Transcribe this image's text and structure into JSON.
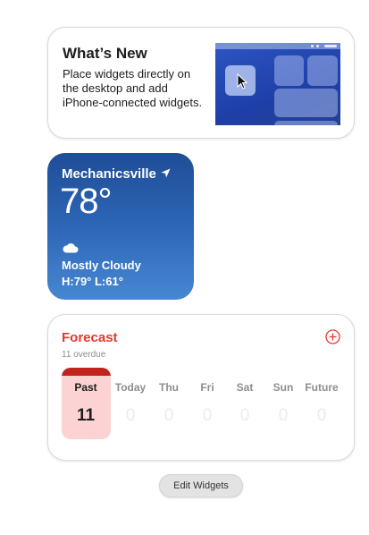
{
  "whats_new": {
    "title": "What’s New",
    "description": "Place widgets directly on the desktop and add iPhone-connected widgets."
  },
  "weather": {
    "city": "Mechanicsville",
    "location_icon": "location-arrow-icon",
    "temperature": "78°",
    "condition_icon": "cloud-icon",
    "condition": "Mostly Cloudy",
    "high_low": "H:79° L:61°"
  },
  "forecast": {
    "title": "Forecast",
    "subtitle": "11 overdue",
    "add_icon": "plus-circle-icon",
    "accent_color": "#e5372c",
    "columns": [
      {
        "label": "Past",
        "count": "11"
      },
      {
        "label": "Today",
        "count": "0"
      },
      {
        "label": "Thu",
        "count": "0"
      },
      {
        "label": "Fri",
        "count": "0"
      },
      {
        "label": "Sat",
        "count": "0"
      },
      {
        "label": "Sun",
        "count": "0"
      },
      {
        "label": "Future",
        "count": "0"
      }
    ]
  },
  "edit_widgets_label": "Edit Widgets"
}
